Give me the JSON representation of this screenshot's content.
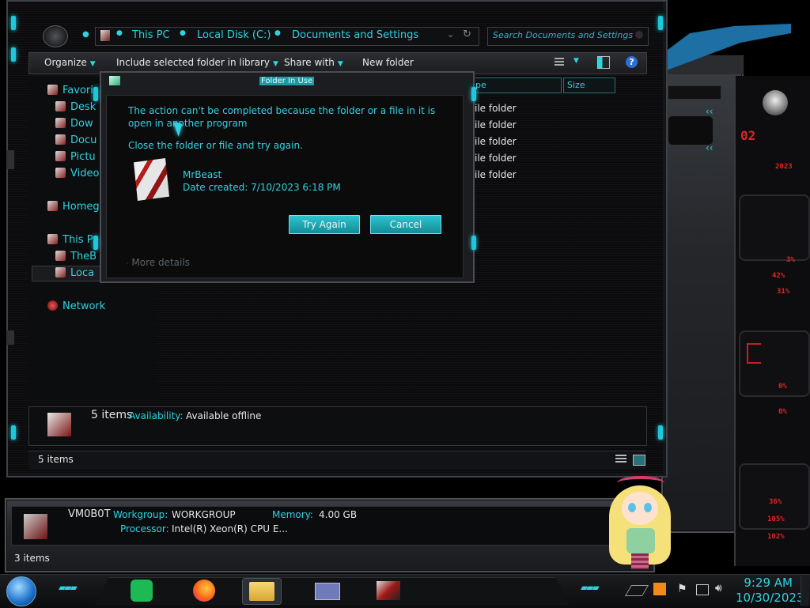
{
  "explorer": {
    "breadcrumb": [
      "This PC",
      "Local Disk (C:)",
      "Documents and Settings"
    ],
    "search_placeholder": "Search Documents and Settings",
    "toolbar": {
      "organize": "Organize",
      "include_library": "Include selected folder in library",
      "share_with": "Share with",
      "new_folder": "New folder"
    },
    "nav": {
      "favorites": "Favori",
      "desktop": "Desk",
      "downloads": "Dow",
      "documents": "Docu",
      "pictures": "Pictu",
      "videos": "Video",
      "homegroup": "Homeg",
      "this_pc": "This P",
      "thebeast": "TheB",
      "local": "Loca",
      "network": "Network"
    },
    "columns": {
      "type": "pe",
      "size": "Size"
    },
    "rows": [
      "ile folder",
      "ile folder",
      "ile folder",
      "ile folder",
      "ile folder"
    ],
    "details": {
      "count": "5 items",
      "availability_label": "Availability:",
      "availability_value": "Available offline"
    },
    "status": "5 items"
  },
  "dialog": {
    "title": "Folder In Use",
    "message": "The action can't be completed because the folder or a file in it is open in another program",
    "hint": "Close the folder or file and try again.",
    "file_name": "MrBeast",
    "date_created": "Date created: 7/10/2023 6:18 PM",
    "try_again": "Try Again",
    "cancel": "Cancel",
    "more_details": "More details"
  },
  "system_window": {
    "computer_name": "VM0B0T",
    "workgroup_label": "Workgroup:",
    "workgroup_value": "WORKGROUP",
    "memory_label": "Memory:",
    "memory_value": "4.00 GB",
    "processor_label": "Processor:",
    "processor_value": "Intel(R) Xeon(R) CPU E...",
    "status": "3 items"
  },
  "gadget": {
    "texts": [
      "02",
      "2023",
      "3%",
      "42%",
      "31%",
      "0%",
      "0%",
      "36%",
      "105%",
      "102%"
    ]
  },
  "clock": {
    "time": "9:29 AM",
    "date": "10/30/2023"
  },
  "colors": {
    "accent": "#2ed3e0",
    "alert": "#e02424"
  }
}
